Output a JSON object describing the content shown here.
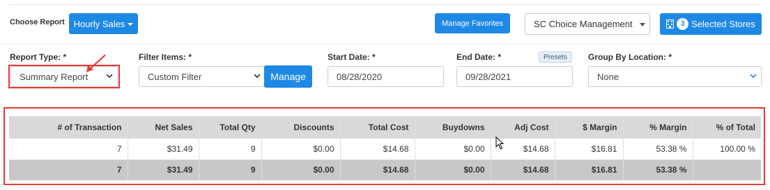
{
  "toolbar": {
    "choose_report_label": "Choose Report",
    "report_button_label": "Hourly Sales",
    "manage_favorites_label": "Manage Favorites",
    "management_select_value": "SC Choice Management",
    "selected_stores_count": "3",
    "selected_stores_label": "Selected Stores"
  },
  "filters": {
    "report_type": {
      "label": "Report Type: *",
      "value": "Summary Report"
    },
    "filter_items": {
      "label": "Filter Items: *",
      "value": "Custom Filter",
      "manage_label": "Manage"
    },
    "start_date": {
      "label": "Start Date: *",
      "value": "08/28/2020"
    },
    "end_date": {
      "label": "End Date: *",
      "value": "09/28/2021",
      "presets_label": "Presets"
    },
    "group_by": {
      "label": "Group By Location: *",
      "value": "None"
    }
  },
  "table": {
    "columns": [
      "# of Transaction",
      "Net Sales",
      "Total Qty",
      "Discounts",
      "Total Cost",
      "Buydowns",
      "Adj Cost",
      "$ Margin",
      "% Margin",
      "% of Total"
    ],
    "rows": [
      [
        "7",
        "$31.49",
        "9",
        "$0.00",
        "$14.68",
        "$0.00",
        "$14.68",
        "$16.81",
        "53.38 %",
        "100.00 %"
      ]
    ],
    "totals": [
      "7",
      "$31.49",
      "9",
      "$0.00",
      "$14.68",
      "$0.00",
      "$14.68",
      "$16.81",
      "53.38 %",
      ""
    ]
  },
  "colors": {
    "accent": "#1e88e5",
    "annotation": "#e53935",
    "header_bg": "#d9d9d9",
    "totals_bg": "#c8c8c8"
  },
  "icons": {
    "stores": "building-icon",
    "cursor": "mouse-pointer-icon",
    "annotation": "red-arrow-annotation"
  }
}
